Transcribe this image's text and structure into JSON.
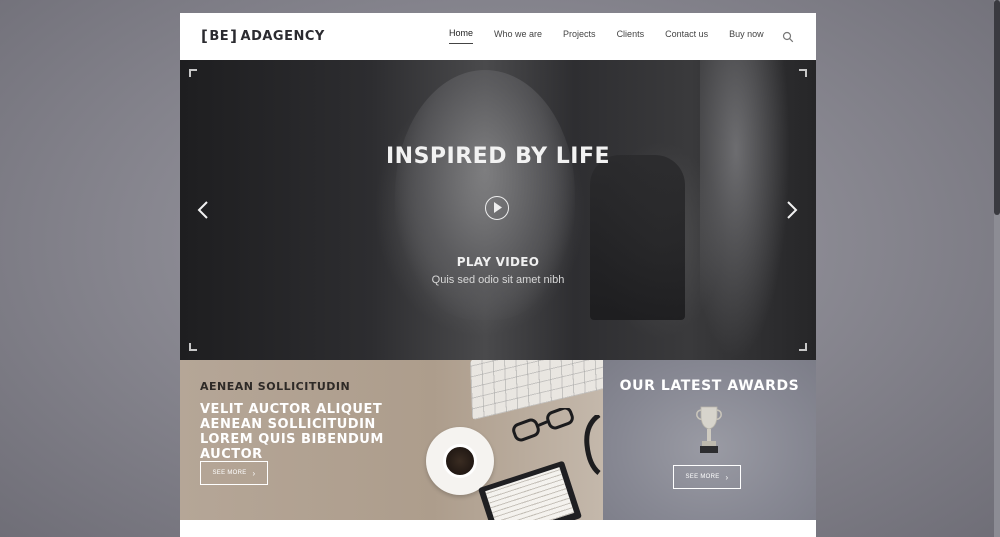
{
  "header": {
    "logo_bracket_open": "[",
    "logo_be": "BE",
    "logo_bracket_close": "]",
    "logo_name": "ADAGENCY",
    "nav": [
      "Home",
      "Who we are",
      "Projects",
      "Clients",
      "Contact us",
      "Buy now"
    ],
    "active_nav": "Home"
  },
  "hero": {
    "title": "INSPIRED BY LIFE",
    "play_label": "PLAY VIDEO",
    "subtitle": "Quis sed odio sit amet nibh"
  },
  "feature": {
    "kicker": "AENEAN SOLLICITUDIN",
    "headline": "VELIT AUCTOR ALIQUET AENEAN SOLLICITUDIN LOREM QUIS BIBENDUM AUCTOR",
    "button_label": "SEE MORE"
  },
  "awards": {
    "title": "OUR LATEST AWARDS",
    "button_label": "SEE MORE"
  },
  "icons": {
    "search": "search-icon",
    "arrow_left": "chevron-left-icon",
    "arrow_right": "chevron-right-icon",
    "play": "play-icon",
    "trophy": "trophy-icon",
    "button_chevron": "chevron-right-icon"
  },
  "colors": {
    "page_bg": "#8a8992",
    "feature_bg": "#b5a697",
    "awards_bg": "#878893",
    "text_dark": "#2b2b30"
  }
}
